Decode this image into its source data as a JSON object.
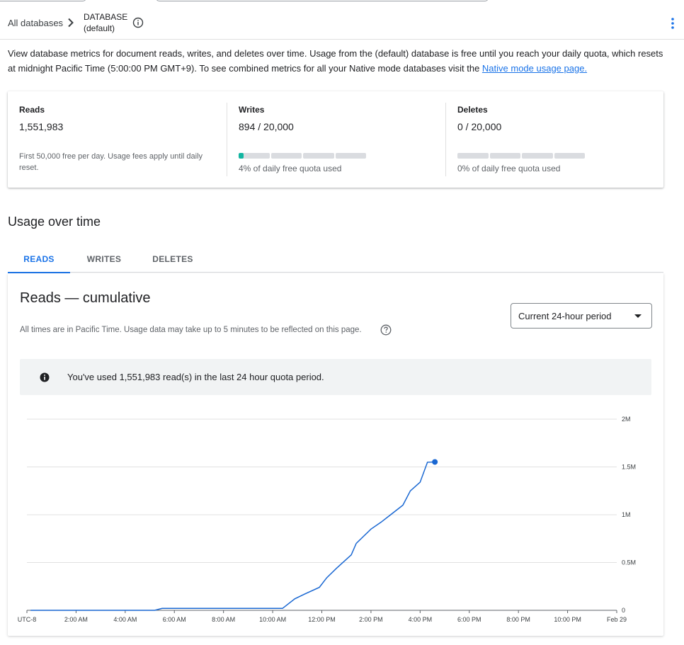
{
  "breadcrumb": {
    "all_databases": "All databases",
    "db_line1": "DATABASE",
    "db_line2": "(default)"
  },
  "intro": {
    "text": "View database metrics for document reads, writes, and deletes over time. Usage from the (default) database is free until you reach your daily quota, which resets at midnight Pacific Time (5:00:00 PM GMT+9). To see combined metrics for all your Native mode databases visit the ",
    "link": "Native mode usage page."
  },
  "stats": {
    "reads": {
      "title": "Reads",
      "value": "1,551,983",
      "note": "First 50,000 free per day. Usage fees apply until daily reset."
    },
    "writes": {
      "title": "Writes",
      "value": "894 / 20,000",
      "quota_fraction": 0.04,
      "caption": "4% of daily free quota used"
    },
    "deletes": {
      "title": "Deletes",
      "value": "0 / 20,000",
      "quota_fraction": 0,
      "caption": "0% of daily free quota used"
    }
  },
  "section_title": "Usage over time",
  "tabs": [
    {
      "label": "READS",
      "active": true
    },
    {
      "label": "WRITES",
      "active": false
    },
    {
      "label": "DELETES",
      "active": false
    }
  ],
  "chart_panel": {
    "title": "Reads — cumulative",
    "subtitle": "All times are in Pacific Time. Usage data may take up to 5 minutes to be reflected on this page.",
    "period_select": "Current 24-hour period",
    "notice": "You've used 1,551,983 read(s) in the last 24 hour quota period."
  },
  "colors": {
    "accent": "#1a73e8",
    "quota_fill": "#12b5a1",
    "series": "#1967d2"
  },
  "icons": {
    "breadcrumb_separator": "chevron-right-icon",
    "db_info": "info-outline-icon",
    "more": "more-vert-icon",
    "help": "help-outline-icon",
    "notice": "info-filled-icon",
    "select_caret": "arrow-drop-down-icon"
  },
  "chart_data": {
    "type": "line",
    "title": "Reads — cumulative",
    "xlabel": "",
    "ylabel": "",
    "x_tick_labels": [
      "UTC-8",
      "2:00 AM",
      "4:00 AM",
      "6:00 AM",
      "8:00 AM",
      "10:00 AM",
      "12:00 PM",
      "2:00 PM",
      "4:00 PM",
      "6:00 PM",
      "8:00 PM",
      "10:00 PM",
      "Feb 29"
    ],
    "y_tick_labels": [
      "0",
      "0.5M",
      "1M",
      "1.5M",
      "2M"
    ],
    "xlim": [
      0,
      24
    ],
    "ylim": [
      0,
      2000000
    ],
    "y_axis_position": "right",
    "grid": true,
    "series": [
      {
        "x": [
          0.15,
          5.2,
          5.5,
          10.4,
          10.9,
          11.3,
          11.9,
          12.2,
          12.6,
          13.2,
          13.4,
          14.0,
          14.4,
          14.8,
          15.3,
          15.6,
          16.0,
          16.3,
          16.6
        ],
        "y": [
          0,
          0,
          20000,
          20000,
          120000,
          170000,
          240000,
          340000,
          440000,
          580000,
          700000,
          850000,
          920000,
          1000000,
          1100000,
          1250000,
          1340000,
          1550000,
          1551983
        ]
      }
    ]
  }
}
